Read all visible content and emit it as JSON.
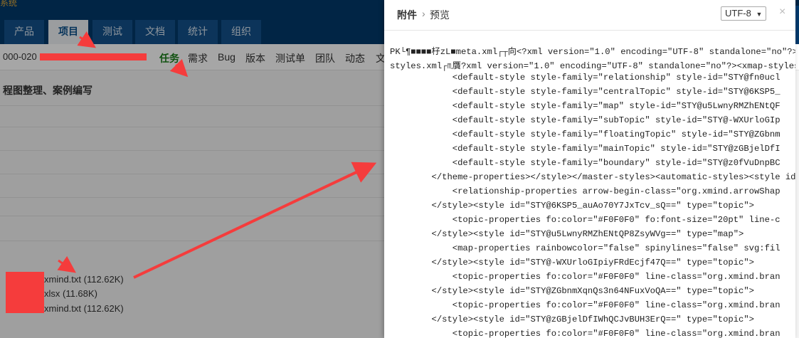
{
  "app": {
    "brand": "系统",
    "nav_tabs": [
      "产品",
      "项目",
      "测试",
      "文档",
      "统计",
      "组织"
    ],
    "project_id": "000-020",
    "sub_links": [
      "任务",
      "需求",
      "Bug",
      "版本",
      "测试单",
      "团队",
      "动态",
      "文"
    ],
    "task_title": "程图整理、案例编写",
    "attachments": [
      "xmind.txt (112.62K)",
      "xlsx (11.68K)",
      "xmind.txt (112.62K)"
    ]
  },
  "modal": {
    "title": "附件",
    "breadcrumb_arrow": "›",
    "breadcrumb_current": "预览",
    "encoding": "UTF-8",
    "encoding_caret": "▼",
    "close_glyph": "×",
    "lines": [
      "PK└¶■■■■杍zL■meta.xml┌┬向<?xml version=\"1.0\" encoding=\"UTF-8\" standalone=\"no\"?><meta x",
      "styles.xml┌♏贋?xml version=\"1.0\" encoding=\"UTF-8\" standalone=\"no\"?><xmap-styles xmlns=",
      "            <default-style style-family=\"relationship\" style-id=\"STY@fn0ucl",
      "            <default-style style-family=\"centralTopic\" style-id=\"STY@6KSP5_",
      "            <default-style style-family=\"map\" style-id=\"STY@u5LwnyRMZhENtQF",
      "            <default-style style-family=\"subTopic\" style-id=\"STY@-WXUrloGIp",
      "            <default-style style-family=\"floatingTopic\" style-id=\"STY@ZGbnm",
      "            <default-style style-family=\"mainTopic\" style-id=\"STY@zGBjelDfI",
      "            <default-style style-family=\"boundary\" style-id=\"STY@z0fVuDnpBC",
      "        </theme-properties></style></master-styles><automatic-styles><style id=",
      "            <relationship-properties arrow-begin-class=\"org.xmind.arrowShap",
      "        </style><style id=\"STY@6KSP5_auAo70Y7JxTcv_sQ==\" type=\"topic\">",
      "            <topic-properties fo:color=\"#F0F0F0\" fo:font-size=\"20pt\" line-c",
      "        </style><style id=\"STY@u5LwnyRMZhENtQP8ZsyWVg==\" type=\"map\">",
      "            <map-properties rainbowcolor=\"false\" spinylines=\"false\" svg:fil",
      "        </style><style id=\"STY@-WXUrloGIpiyFRdEcjf47Q==\" type=\"topic\">",
      "            <topic-properties fo:color=\"#F0F0F0\" line-class=\"org.xmind.bran",
      "        </style><style id=\"STY@ZGbnmXqnQs3n64NFuxVoQA==\" type=\"topic\">",
      "            <topic-properties fo:color=\"#F0F0F0\" line-class=\"org.xmind.bran",
      "        </style><style id=\"STY@zGBjelDfIWhQCJvBUH3ErQ==\" type=\"topic\">",
      "            <topic-properties fo:color=\"#F0F0F0\" line-class=\"org.xmind.bran"
    ]
  },
  "colors": {
    "nav_bg": "#03396b",
    "annotation_red": "#f53c3c",
    "active_subnav": "#1a7d1a"
  }
}
